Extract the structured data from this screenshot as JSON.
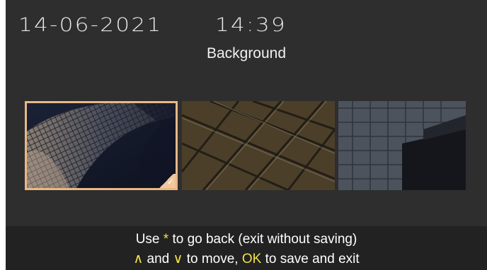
{
  "header": {
    "date": "14-06-2021",
    "time": "14:39"
  },
  "title": "Background",
  "backgrounds": [
    {
      "name": "Curved facade",
      "selected": true,
      "check": "✓"
    },
    {
      "name": "Glass roof grid",
      "selected": false
    },
    {
      "name": "Glass building",
      "selected": false
    }
  ],
  "footer": {
    "line1_prefix": "Use ",
    "line1_key": "*",
    "line1_suffix": " to go back (exit without saving)",
    "line2_up": "∧",
    "line2_and": " and ",
    "line2_down": "∨",
    "line2_move": " to move, ",
    "line2_ok": "OK",
    "line2_suffix": " to save and exit"
  },
  "colors": {
    "screen_bg": "#2e2e2e",
    "footer_bg": "#222222",
    "selection_border": "#e8b886",
    "key_highlight": "#f0e24a"
  }
}
